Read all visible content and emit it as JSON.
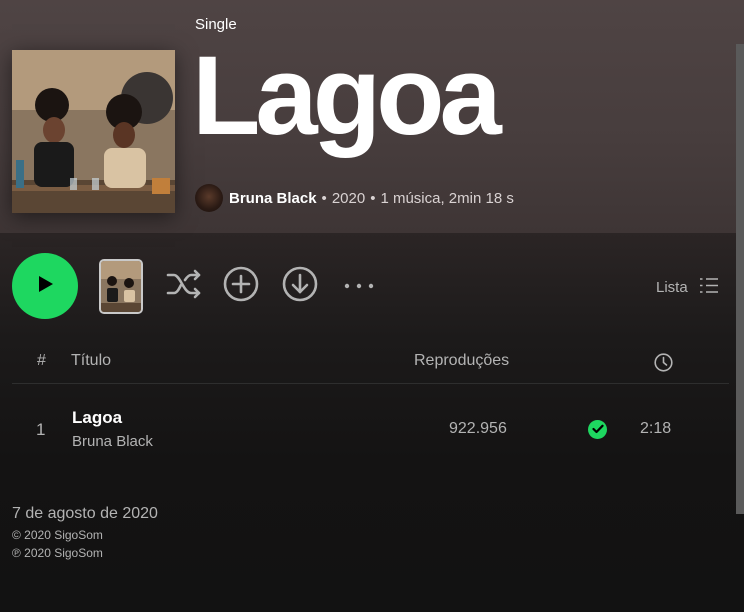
{
  "album": {
    "type": "Single",
    "title": "Lagoa",
    "artist": "Bruna Black",
    "year": "2020",
    "count_duration": "1 música, 2min 18 s",
    "separator": "•"
  },
  "controls": {
    "view_label": "Lista"
  },
  "table": {
    "headers": {
      "number": "#",
      "title": "Título",
      "plays": "Reproduções"
    },
    "rows": [
      {
        "number": "1",
        "title": "Lagoa",
        "artist": "Bruna Black",
        "plays": "922.956",
        "duration": "2:18"
      }
    ]
  },
  "footer": {
    "release_date": "7 de agosto de 2020",
    "copyright": "© 2020 SigoSom",
    "phonogram": "℗ 2020 SigoSom"
  },
  "colors": {
    "accent": "#1ed760",
    "header_bg": "#4f4444",
    "background": "#121212"
  },
  "icons": [
    "play-icon",
    "shuffle-icon",
    "add-circle-icon",
    "download-icon",
    "more-icon",
    "list-icon",
    "clock-icon",
    "check-icon"
  ]
}
